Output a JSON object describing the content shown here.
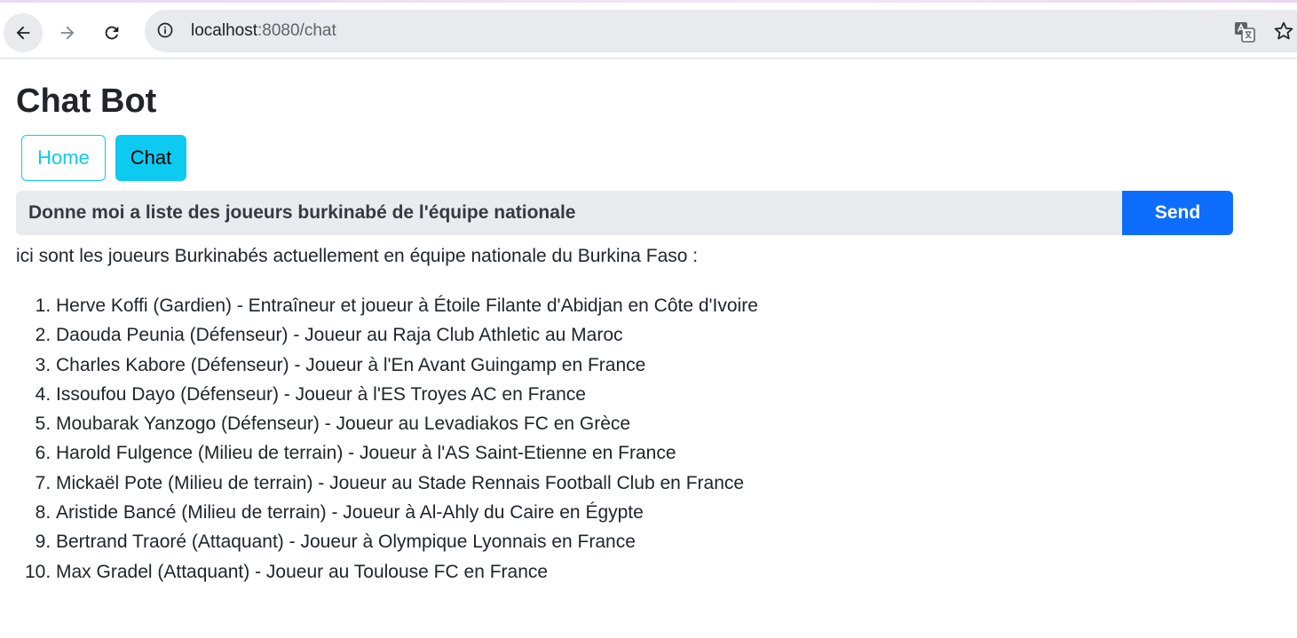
{
  "browser": {
    "url_host": "localhost",
    "url_rest": ":8080/chat"
  },
  "page": {
    "title": "Chat Bot",
    "nav": {
      "home_label": "Home",
      "chat_label": "Chat"
    },
    "input": {
      "value": "Donne moi a liste des joueurs burkinabé de l'équipe nationale"
    },
    "send_label": "Send",
    "response": {
      "intro": "ici sont les joueurs Burkinabés actuellement en équipe nationale du Burkina Faso :",
      "items": [
        "Herve Koffi (Gardien) - Entraîneur et joueur à Étoile Filante d'Abidjan en Côte d'Ivoire",
        "Daouda Peunia (Défenseur) - Joueur au Raja Club Athletic au Maroc",
        "Charles Kabore (Défenseur) - Joueur à l'En Avant Guingamp en France",
        "Issoufou Dayo (Défenseur) - Joueur à l'ES Troyes AC en France",
        "Moubarak Yanzogo (Défenseur) - Joueur au Levadiakos FC en Grèce",
        "Harold Fulgence (Milieu de terrain) - Joueur à l'AS Saint-Etienne en France",
        "Mickaël Pote (Milieu de terrain) - Joueur au Stade Rennais Football Club en France",
        "Aristide Bancé (Milieu de terrain) - Joueur à Al-Ahly du Caire en Égypte",
        "Bertrand Traoré (Attaquant) - Joueur à Olympique Lyonnais en France",
        "Max Gradel (Attaquant) - Joueur au Toulouse FC en France"
      ]
    }
  },
  "colors": {
    "info": "#0dcaf0",
    "primary": "#0d6efd",
    "input_bg": "#e9ecef"
  },
  "icons": {
    "back": "arrow-left-icon",
    "forward": "arrow-right-icon",
    "reload": "reload-icon",
    "site_info": "info-circle-icon",
    "translate": "translate-icon",
    "bookmark": "star-icon"
  }
}
